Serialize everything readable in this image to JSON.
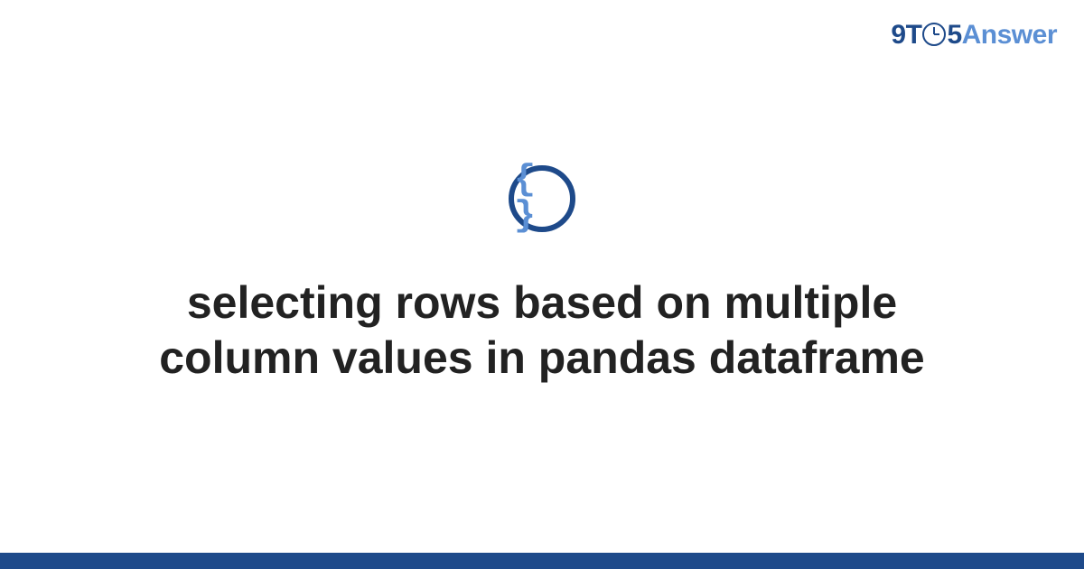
{
  "brand": {
    "prefix": "9T",
    "suffix": "5",
    "answer": "Answer"
  },
  "icon": {
    "glyph": "{ }"
  },
  "title": "selecting rows based on multiple column values in pandas dataframe",
  "colors": {
    "primary": "#1e4a8a",
    "accent": "#5b8fd4",
    "text": "#222222"
  }
}
